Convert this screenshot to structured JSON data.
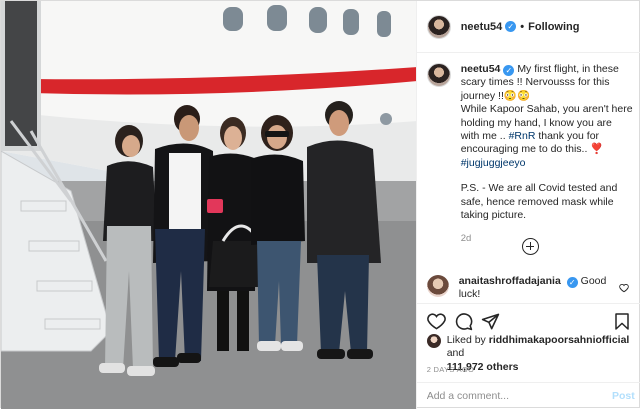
{
  "header": {
    "username": "neetu54",
    "verified_icon": "verified-badge-icon",
    "separator": "•",
    "follow_status": "Following"
  },
  "caption": {
    "username": "neetu54",
    "line1": "My first flight, in these scary times !! Nervousss for this journey !!😳😳",
    "line2_a": "While Kapoor Sahab, you aren't here holding my hand, I know you are with me .. ",
    "tag1": "#RnR",
    "line2_b": " thank you for encouraging me to do this.. ❣️ ",
    "tag2": "#jugjuggjeeyo",
    "ps": "P.S. - We are all Covid tested and safe, hence removed mask while taking picture.",
    "time": "2d"
  },
  "comment": {
    "username": "anaitashroffadajania",
    "text": "Good luck!"
  },
  "likes": {
    "prefix": "Liked by ",
    "user": "riddhimakapoorsahniofficial",
    "and": " and",
    "count": "111,972 others"
  },
  "date": "2 DAYS AGO",
  "add_comment": {
    "placeholder": "Add a comment...",
    "post_label": "Post"
  },
  "colors": {
    "link": "#00376b",
    "verified": "#3897f0",
    "post_disabled": "#b2dffc",
    "jet_stripe": "#d8262b"
  }
}
